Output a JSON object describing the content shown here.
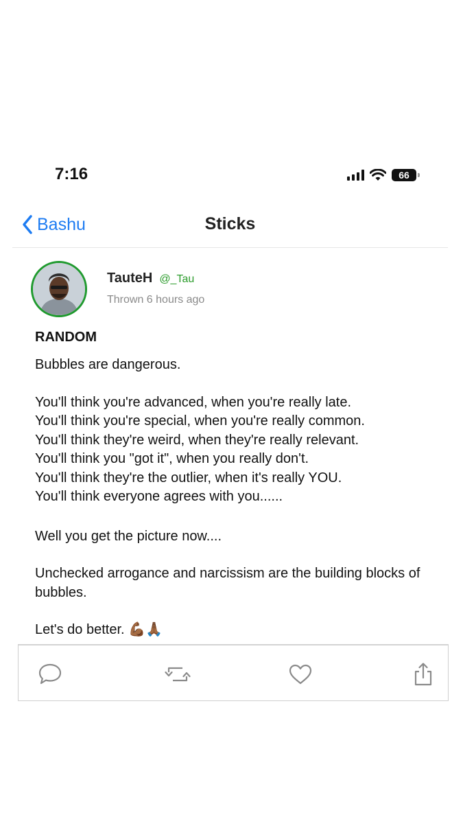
{
  "status_bar": {
    "time": "7:16",
    "battery": "66"
  },
  "nav": {
    "back_label": "Bashu",
    "title": "Sticks"
  },
  "post": {
    "author": {
      "name": "TauteH",
      "handle": "@_Tau"
    },
    "timestamp": "Thrown 6 hours ago",
    "title": "RANDOM",
    "body": {
      "line1": "Bubbles are dangerous.",
      "list": [
        "You'll think you're advanced, when you're really late.",
        "You'll think you're special, when you're really common.",
        "You'll think they're weird, when they're really relevant.",
        "You'll think you \"got it\", when you really don't.",
        "You'll think they're the outlier, when it's really YOU.",
        "You'll think everyone agrees with you......"
      ],
      "line2": "Well you get the picture now....",
      "line3": "Unchecked arrogance and narcissism are the building blocks of bubbles.",
      "line4": "Let's do better. 💪🏾🙏🏾"
    }
  },
  "actions": [
    {
      "icon": "comment-icon"
    },
    {
      "icon": "repost-icon"
    },
    {
      "icon": "heart-icon"
    },
    {
      "icon": "share-icon"
    }
  ],
  "colors": {
    "accent": "#1e7cf2",
    "handle": "#2a9b2a",
    "avatar_ring": "#1f9a2e"
  }
}
